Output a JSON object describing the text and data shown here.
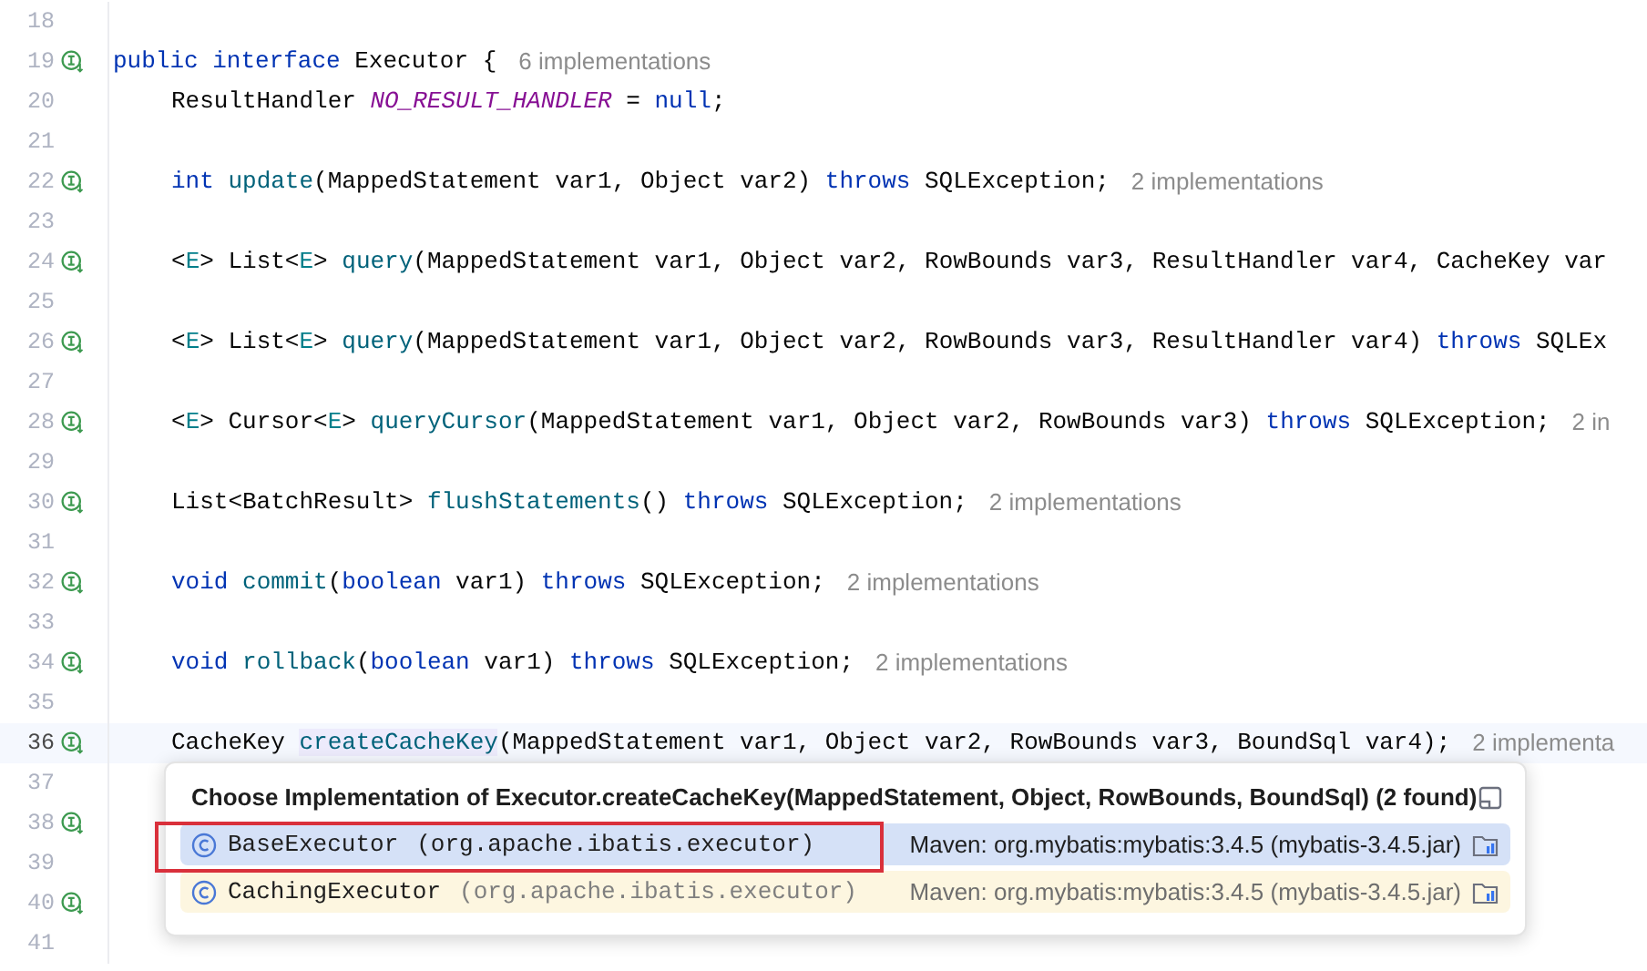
{
  "editor": {
    "lines": [
      {
        "number": "18",
        "gutter_icon": false,
        "current": false
      },
      {
        "number": "19",
        "gutter_icon": true,
        "current": false,
        "tokens": [
          {
            "text": "public interface",
            "kind": "keyword"
          },
          {
            "text": " Executor {",
            "kind": "plain"
          }
        ],
        "hint": "6 implementations",
        "children": [
          {
            "number": "20",
            "gutter_icon": false,
            "current": false,
            "tokens": [
              {
                "text": "ResultHandler ",
                "kind": "plain"
              },
              {
                "text": "NO_RESULT_HANDLER",
                "kind": "field"
              },
              {
                "text": " = ",
                "kind": "plain"
              },
              {
                "text": "null",
                "kind": "keyword"
              },
              {
                "text": ";",
                "kind": "plain"
              }
            ]
          },
          {
            "number": "21",
            "gutter_icon": false,
            "current": false
          },
          {
            "number": "22",
            "gutter_icon": true,
            "current": false,
            "tokens": [
              {
                "text": "int ",
                "kind": "keyword"
              },
              {
                "text": "update",
                "kind": "method"
              },
              {
                "text": "(MappedStatement var1, Object var2) ",
                "kind": "plain"
              },
              {
                "text": "throws",
                "kind": "keyword"
              },
              {
                "text": " SQLException;",
                "kind": "plain"
              }
            ],
            "hint": "2 implementations"
          },
          {
            "number": "23",
            "gutter_icon": false,
            "current": false
          },
          {
            "number": "24",
            "gutter_icon": true,
            "current": false,
            "tokens": [
              {
                "text": "<",
                "kind": "plain"
              },
              {
                "text": "E",
                "kind": "type_param"
              },
              {
                "text": "> List<",
                "kind": "plain"
              },
              {
                "text": "E",
                "kind": "type_param"
              },
              {
                "text": "> ",
                "kind": "plain"
              },
              {
                "text": "query",
                "kind": "method"
              },
              {
                "text": "(MappedStatement var1, Object var2, RowBounds var3, ResultHandler var4, CacheKey var",
                "kind": "plain"
              }
            ]
          },
          {
            "number": "25",
            "gutter_icon": false,
            "current": false
          },
          {
            "number": "26",
            "gutter_icon": true,
            "current": false,
            "tokens": [
              {
                "text": "<",
                "kind": "plain"
              },
              {
                "text": "E",
                "kind": "type_param"
              },
              {
                "text": "> List<",
                "kind": "plain"
              },
              {
                "text": "E",
                "kind": "type_param"
              },
              {
                "text": "> ",
                "kind": "plain"
              },
              {
                "text": "query",
                "kind": "method"
              },
              {
                "text": "(MappedStatement var1, Object var2, RowBounds var3, ResultHandler var4) ",
                "kind": "plain"
              },
              {
                "text": "throws",
                "kind": "keyword"
              },
              {
                "text": " SQLEx",
                "kind": "plain"
              }
            ]
          },
          {
            "number": "27",
            "gutter_icon": false,
            "current": false
          },
          {
            "number": "28",
            "gutter_icon": true,
            "current": false,
            "tokens": [
              {
                "text": "<",
                "kind": "plain"
              },
              {
                "text": "E",
                "kind": "type_param"
              },
              {
                "text": "> Cursor<",
                "kind": "plain"
              },
              {
                "text": "E",
                "kind": "type_param"
              },
              {
                "text": "> ",
                "kind": "plain"
              },
              {
                "text": "queryCursor",
                "kind": "method"
              },
              {
                "text": "(MappedStatement var1, Object var2, RowBounds var3) ",
                "kind": "plain"
              },
              {
                "text": "throws",
                "kind": "keyword"
              },
              {
                "text": " SQLException;",
                "kind": "plain"
              }
            ],
            "hint": "2 in"
          },
          {
            "number": "29",
            "gutter_icon": false,
            "current": false
          },
          {
            "number": "30",
            "gutter_icon": true,
            "current": false,
            "tokens": [
              {
                "text": "List<BatchResult> ",
                "kind": "plain"
              },
              {
                "text": "flushStatements",
                "kind": "method"
              },
              {
                "text": "() ",
                "kind": "plain"
              },
              {
                "text": "throws",
                "kind": "keyword"
              },
              {
                "text": " SQLException;",
                "kind": "plain"
              }
            ],
            "hint": "2 implementations"
          },
          {
            "number": "31",
            "gutter_icon": false,
            "current": false
          },
          {
            "number": "32",
            "gutter_icon": true,
            "current": false,
            "tokens": [
              {
                "text": "void ",
                "kind": "keyword"
              },
              {
                "text": "commit",
                "kind": "method"
              },
              {
                "text": "(",
                "kind": "plain"
              },
              {
                "text": "boolean",
                "kind": "keyword"
              },
              {
                "text": " var1) ",
                "kind": "plain"
              },
              {
                "text": "throws",
                "kind": "keyword"
              },
              {
                "text": " SQLException;",
                "kind": "plain"
              }
            ],
            "hint": "2 implementations"
          },
          {
            "number": "33",
            "gutter_icon": false,
            "current": false
          },
          {
            "number": "34",
            "gutter_icon": true,
            "current": false,
            "tokens": [
              {
                "text": "void ",
                "kind": "keyword"
              },
              {
                "text": "rollback",
                "kind": "method"
              },
              {
                "text": "(",
                "kind": "plain"
              },
              {
                "text": "boolean",
                "kind": "keyword"
              },
              {
                "text": " var1) ",
                "kind": "plain"
              },
              {
                "text": "throws",
                "kind": "keyword"
              },
              {
                "text": " SQLException;",
                "kind": "plain"
              }
            ],
            "hint": "2 implementations"
          },
          {
            "number": "35",
            "gutter_icon": false,
            "current": false
          },
          {
            "number": "36",
            "gutter_icon": true,
            "current": true,
            "tokens": [
              {
                "text": "CacheKey ",
                "kind": "plain"
              },
              {
                "text": "createCacheKey",
                "kind": "method_highlighted"
              },
              {
                "text": "(MappedStatement var1, Object var2, RowBounds var3, BoundSql var4);",
                "kind": "plain"
              }
            ],
            "hint": "2 implementa"
          },
          {
            "number": "37",
            "gutter_icon": false,
            "current": false
          },
          {
            "number": "38",
            "gutter_icon": true,
            "current": false
          },
          {
            "number": "39",
            "gutter_icon": false,
            "current": false
          },
          {
            "number": "40",
            "gutter_icon": true,
            "current": false
          },
          {
            "number": "41",
            "gutter_icon": false,
            "current": false
          }
        ]
      }
    ]
  },
  "popup": {
    "title": "Choose Implementation of Executor.createCacheKey(MappedStatement, Object, RowBounds, BoundSql) (2 found)",
    "items": [
      {
        "name": "BaseExecutor",
        "package": "(org.apache.ibatis.executor)",
        "source": "Maven: org.mybatis:mybatis:3.4.5 (mybatis-3.4.5.jar)",
        "selected": true
      },
      {
        "name": "CachingExecutor",
        "package": "(org.apache.ibatis.executor)",
        "source": "Maven: org.mybatis:mybatis:3.4.5 (mybatis-3.4.5.jar)",
        "selected": false
      }
    ]
  }
}
